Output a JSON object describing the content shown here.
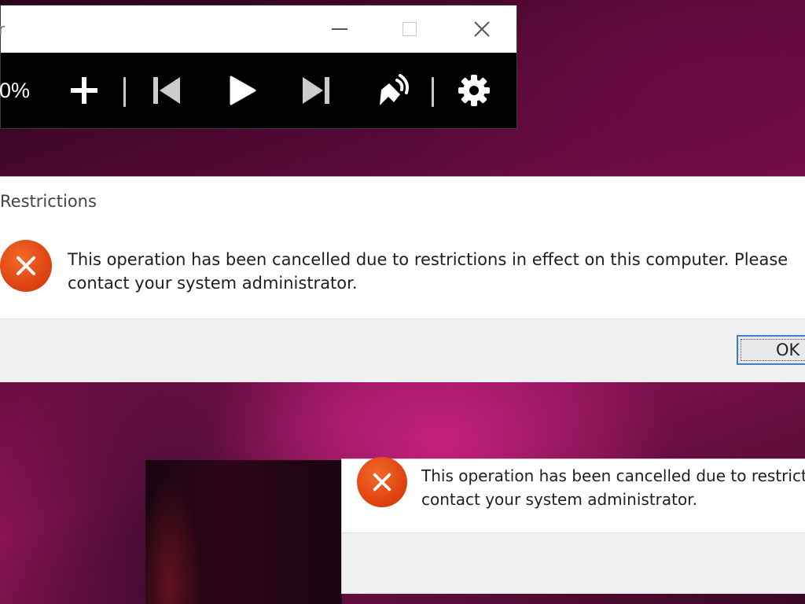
{
  "player": {
    "title": "r",
    "zoom_label": "0%",
    "icons": [
      "plus-icon",
      "skip-back-icon",
      "play-icon",
      "skip-forward-icon",
      "volume-icon",
      "gear-icon"
    ]
  },
  "dialog": {
    "title": "Restrictions",
    "message": "This operation has been cancelled due to restrictions in effect on this computer. Please contact your system administrator.",
    "ok_label": "OK",
    "icon": "error-icon",
    "icon_color": "#e04512"
  },
  "dialog_back": {
    "message_line1": "This operation has been cancelled due to restrict",
    "message_line2": "contact your system administrator.",
    "icon": "error-icon"
  }
}
